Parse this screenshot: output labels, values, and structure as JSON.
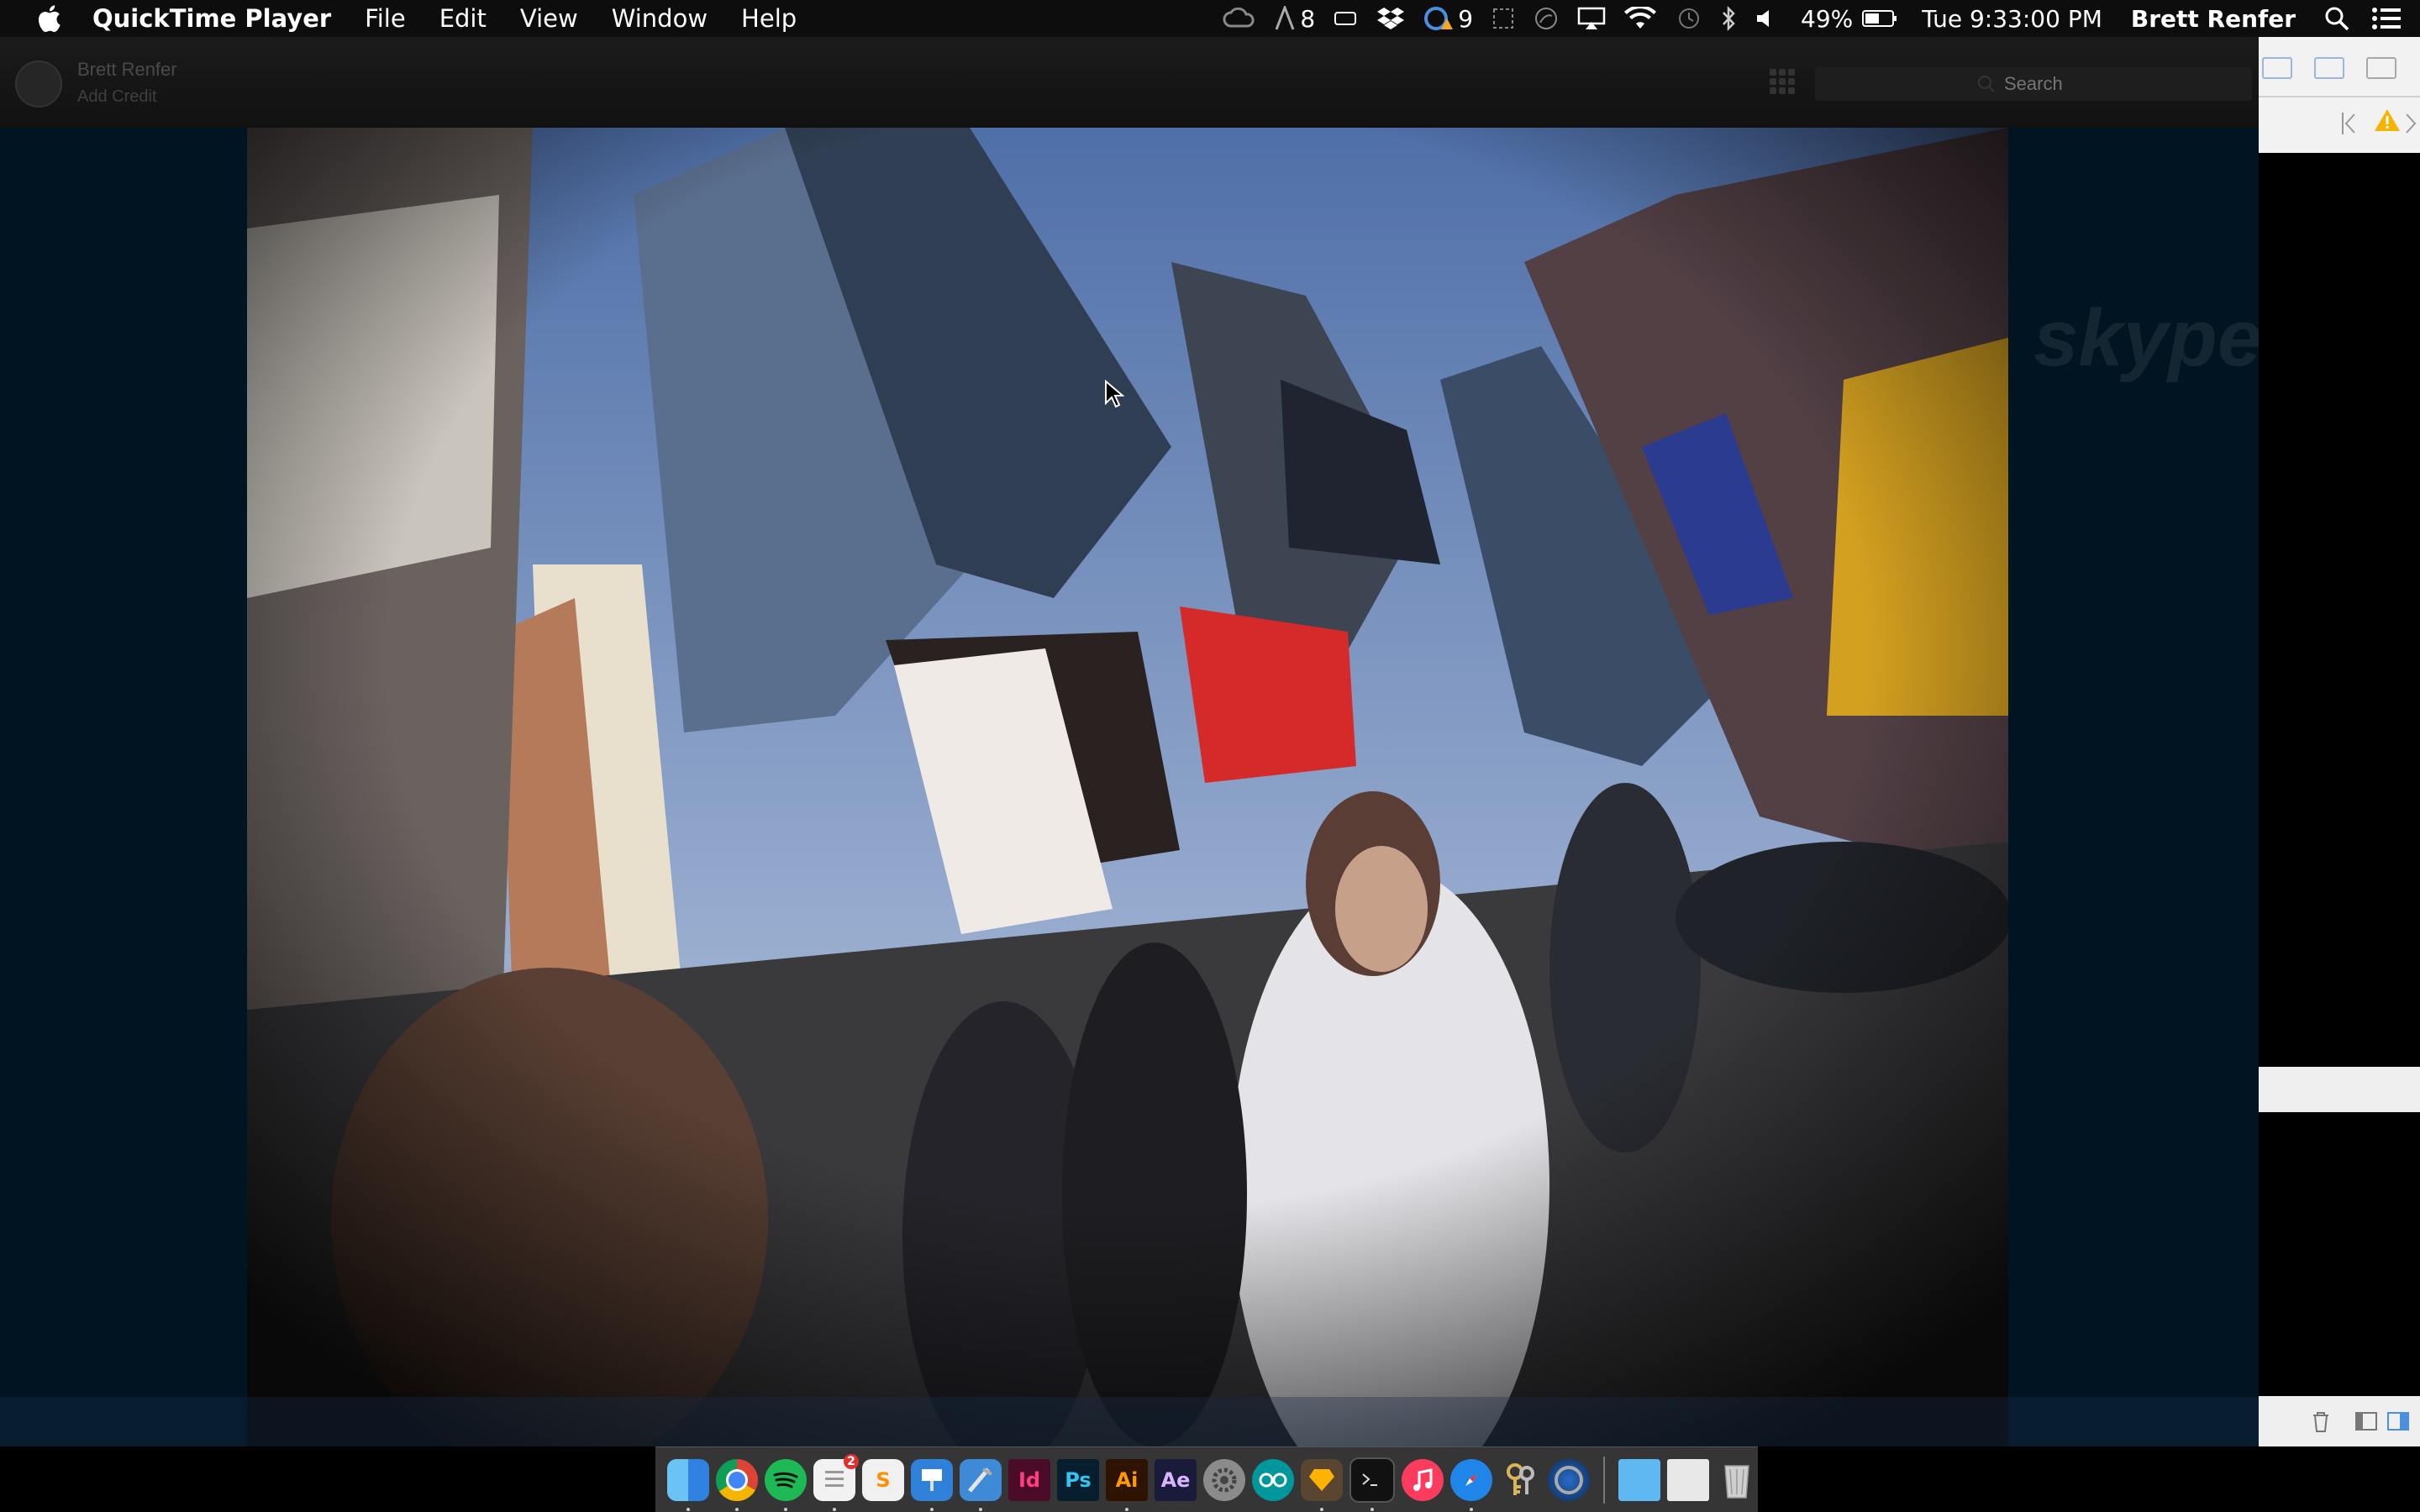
{
  "menubar": {
    "app_name": "QuickTime Player",
    "items": [
      "File",
      "Edit",
      "View",
      "Window",
      "Help"
    ],
    "status_icons": [
      "creative-cloud-icon",
      "font-count-icon",
      "battery-outline-icon",
      "dropbox-icon",
      "sync-warning-icon",
      "screenshot-icon",
      "time-machine-icon",
      "airplay-icon",
      "wifi-icon",
      "history-icon",
      "bluetooth-icon",
      "volume-icon"
    ],
    "font_count": "8",
    "notification_count": "9",
    "battery_percent": "49%",
    "clock": "Tue 9:33:00 PM",
    "user": "Brett Renfer"
  },
  "skype": {
    "profile_name": "Brett Renfer",
    "profile_sub": "Add Credit",
    "search_placeholder": "Search",
    "watermark": "skype"
  },
  "dock": {
    "apps": [
      "Finder",
      "Chrome",
      "Spotify",
      "Reminders",
      "Sublime Text",
      "Keynote",
      "Xcode",
      "InDesign",
      "Photoshop",
      "Illustrator",
      "After Effects",
      "System Preferences",
      "Arduino",
      "Sketch",
      "Terminal",
      "iTunes",
      "Safari",
      "Keychain Access",
      "Camera",
      "Applications",
      "Mail",
      "Trash"
    ],
    "badge": "2",
    "labels": {
      "id": "Id",
      "ps": "Ps",
      "ai": "Ai",
      "ae": "Ae",
      "s": "S"
    }
  },
  "colors": {
    "menubar_bg": "#0d0d0d",
    "skype_bg": "#01101a",
    "side_panel_bg": "#f2f2f2",
    "warning": "#f5b400",
    "accent_blue": "#4a8fe0"
  }
}
